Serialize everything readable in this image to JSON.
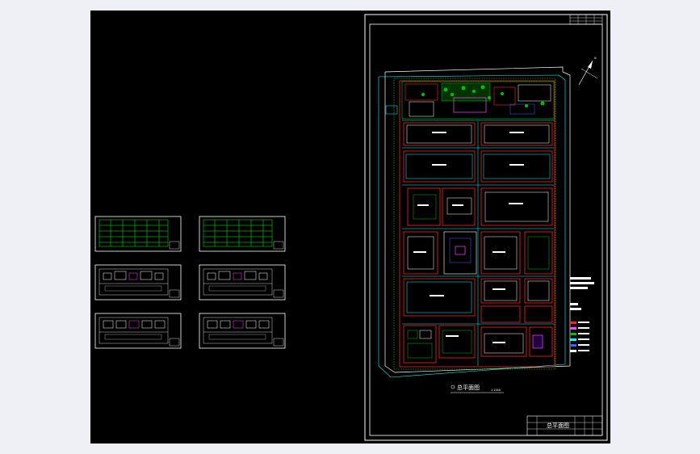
{
  "app": {
    "viewport": "drawing-viewport",
    "colors": {
      "background": "#000000",
      "frame": "#ffffff",
      "site": "#ff2020",
      "road": "#00ffff",
      "green": "#00c000",
      "blue": "#4060ff",
      "magenta": "#ff40ff"
    }
  },
  "drawing": {
    "plan_caption": "总平面图",
    "scale_note": "1:1000",
    "titleblock_text": "总平面图"
  }
}
